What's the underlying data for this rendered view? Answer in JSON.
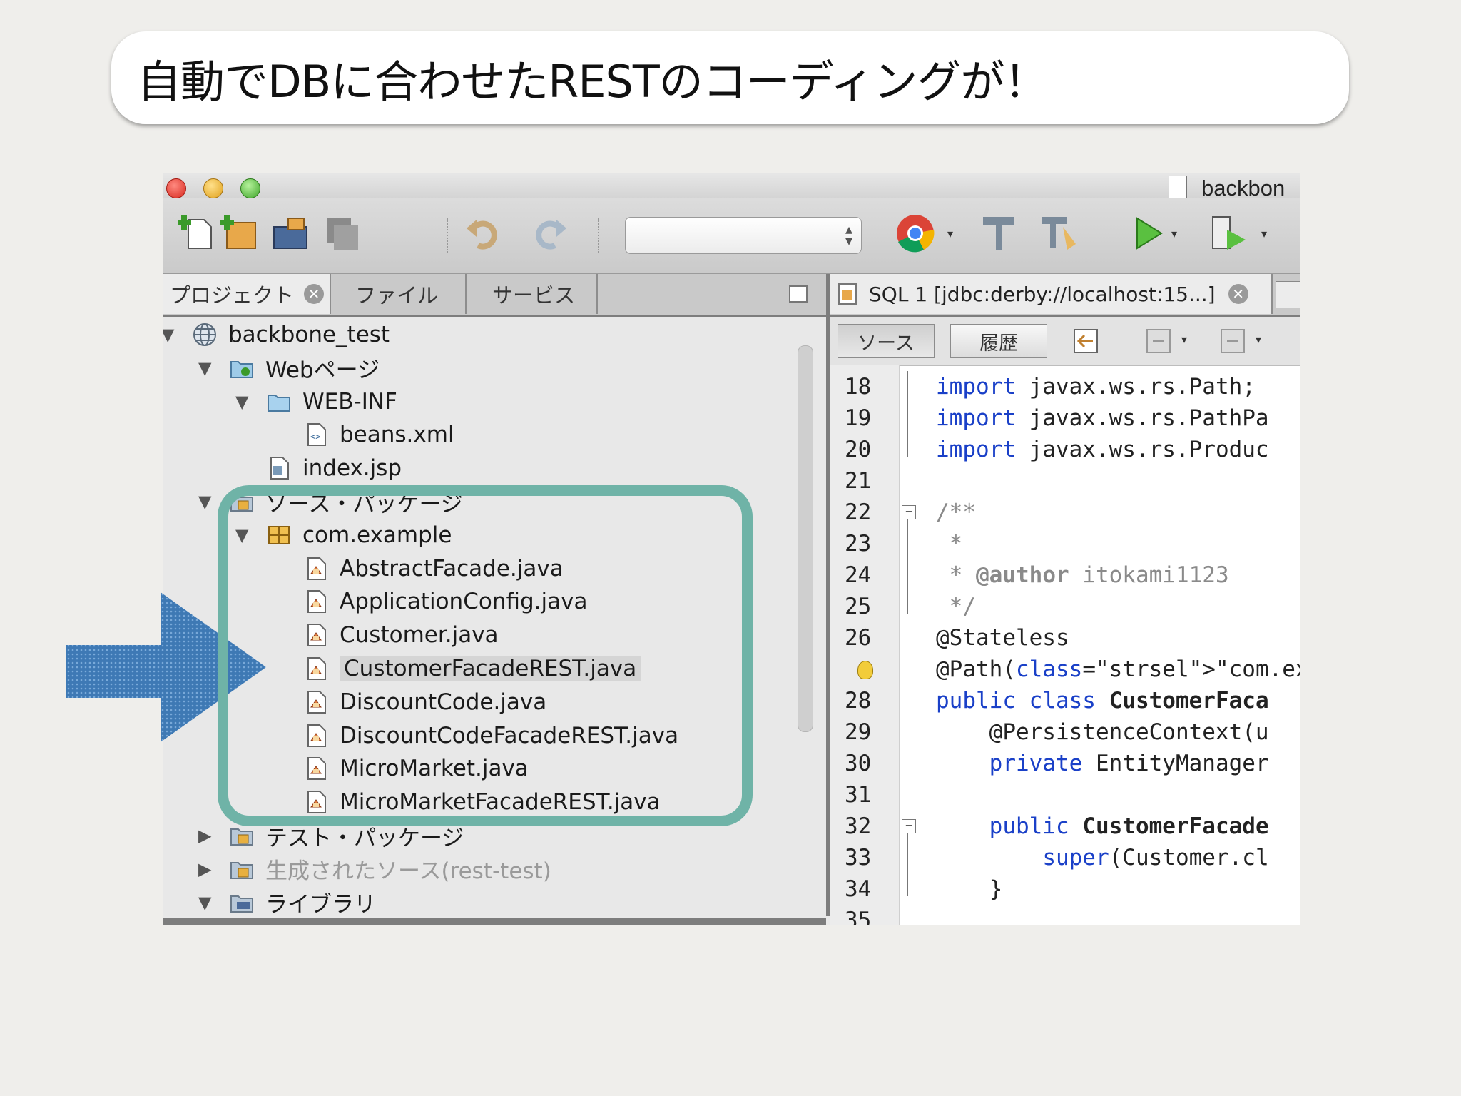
{
  "banner": {
    "text": "自動でDBに合わせたRESTのコーディングが！"
  },
  "window": {
    "title": "backbon"
  },
  "left_tabs": [
    {
      "label": "プロジェクト"
    },
    {
      "label": "ファイル"
    },
    {
      "label": "サービス"
    }
  ],
  "tree": [
    {
      "label": "backbone_test",
      "icon": "globe-project-icon",
      "indent": 0,
      "expanded": true
    },
    {
      "label": "Webページ",
      "icon": "web-folder-icon",
      "indent": 1,
      "expanded": true
    },
    {
      "label": "WEB-INF",
      "icon": "folder-icon",
      "indent": 2,
      "expanded": true
    },
    {
      "label": "beans.xml",
      "icon": "xml-file-icon",
      "indent": 3
    },
    {
      "label": "index.jsp",
      "icon": "jsp-file-icon",
      "indent": 2
    },
    {
      "label": "ソース・パッケージ",
      "icon": "package-folder-icon",
      "indent": 1,
      "expanded": true
    },
    {
      "label": "com.example",
      "icon": "package-icon",
      "indent": 2,
      "expanded": true
    },
    {
      "label": "AbstractFacade.java",
      "icon": "java-file-icon",
      "indent": 3
    },
    {
      "label": "ApplicationConfig.java",
      "icon": "java-file-icon",
      "indent": 3
    },
    {
      "label": "Customer.java",
      "icon": "java-file-icon",
      "indent": 3
    },
    {
      "label": "CustomerFacadeREST.java",
      "icon": "java-file-icon",
      "indent": 3,
      "selected": true
    },
    {
      "label": "DiscountCode.java",
      "icon": "java-file-icon",
      "indent": 3
    },
    {
      "label": "DiscountCodeFacadeREST.java",
      "icon": "java-file-icon",
      "indent": 3
    },
    {
      "label": "MicroMarket.java",
      "icon": "java-file-icon",
      "indent": 3
    },
    {
      "label": "MicroMarketFacadeREST.java",
      "icon": "java-file-icon",
      "indent": 3
    },
    {
      "label": "テスト・パッケージ",
      "icon": "package-folder-icon",
      "indent": 1,
      "expanded": false
    },
    {
      "label": "生成されたソース(rest-test)",
      "icon": "package-folder-icon",
      "indent": 1,
      "expanded": false,
      "dim": true
    },
    {
      "label": "ライブラリ",
      "icon": "library-icon",
      "indent": 1,
      "expanded": true
    }
  ],
  "editor": {
    "tab_label": "SQL 1 [jdbc:derby://localhost:15...]",
    "source_btn": "ソース",
    "history_btn": "履歴"
  },
  "code": [
    {
      "n": "18",
      "t": "import javax.ws.rs.Path;"
    },
    {
      "n": "19",
      "t": "import javax.ws.rs.PathPa"
    },
    {
      "n": "20",
      "t": "import javax.ws.rs.Produc"
    },
    {
      "n": "21",
      "t": ""
    },
    {
      "n": "22",
      "t": "/**"
    },
    {
      "n": "23",
      "t": " *"
    },
    {
      "n": "24",
      "t": " * @author itokami1123"
    },
    {
      "n": "25",
      "t": " */"
    },
    {
      "n": "26",
      "t": "@Stateless"
    },
    {
      "n": "",
      "t": "@Path(\"com.example.custom"
    },
    {
      "n": "28",
      "t": "public class CustomerFaca"
    },
    {
      "n": "29",
      "t": "    @PersistenceContext(u"
    },
    {
      "n": "30",
      "t": "    private EntityManager"
    },
    {
      "n": "31",
      "t": ""
    },
    {
      "n": "32",
      "t": "    public CustomerFacade"
    },
    {
      "n": "33",
      "t": "        super(Customer.cl"
    },
    {
      "n": "34",
      "t": "    }"
    },
    {
      "n": "35",
      "t": ""
    }
  ],
  "colors": {
    "highlight_box": "#6fb3a7",
    "arrow": "#2f6fb0",
    "keyword": "#1a40c8"
  }
}
